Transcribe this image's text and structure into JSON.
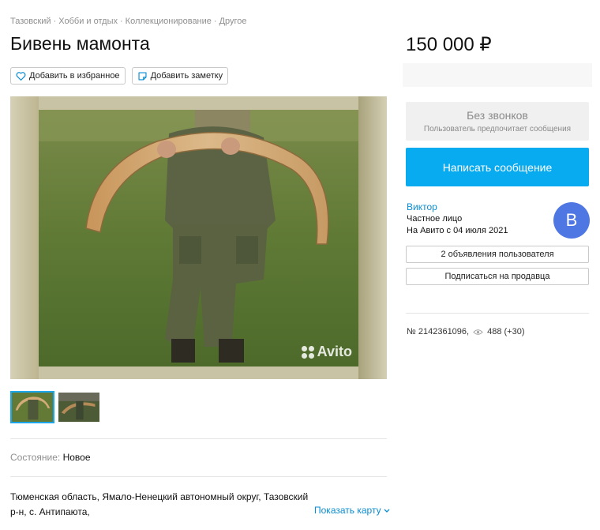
{
  "breadcrumbs": [
    {
      "label": "Тазовский"
    },
    {
      "label": "Хобби и отдых"
    },
    {
      "label": "Коллекционирование"
    },
    {
      "label": "Другое"
    }
  ],
  "breadcrumb_separator": "·",
  "listing": {
    "title": "Бивень мамонта",
    "price": "150 000 ₽",
    "add_favorite_label": "Добавить в избранное",
    "add_note_label": "Добавить заметку",
    "watermark": "Avito",
    "condition_label": "Состояние:",
    "condition_value": "Новое",
    "address_line1": "Тюменская область, Ямало-Ненецкий автономный округ, Тазовский",
    "address_line2": "р-н, с. Антипаюта,",
    "show_map_label": "Показать карту",
    "thumbnail_count": 2,
    "active_thumbnail": 1
  },
  "contact": {
    "no_calls_title": "Без звонков",
    "no_calls_subtitle": "Пользователь предпочитает сообщения",
    "write_button": "Написать сообщение"
  },
  "seller": {
    "name": "Виктор",
    "type": "Частное лицо",
    "since": "На Авито с 04 июля 2021",
    "avatar_letter": "В",
    "listings_button": "2 объявления пользователя",
    "subscribe_button": "Подписаться на продавца"
  },
  "meta": {
    "item_number": "№ 2142361096,",
    "views": "488 (+30)"
  },
  "colors": {
    "accent": "#08aaf0",
    "link": "#0a8dd3",
    "avatar": "#4f77e4"
  }
}
